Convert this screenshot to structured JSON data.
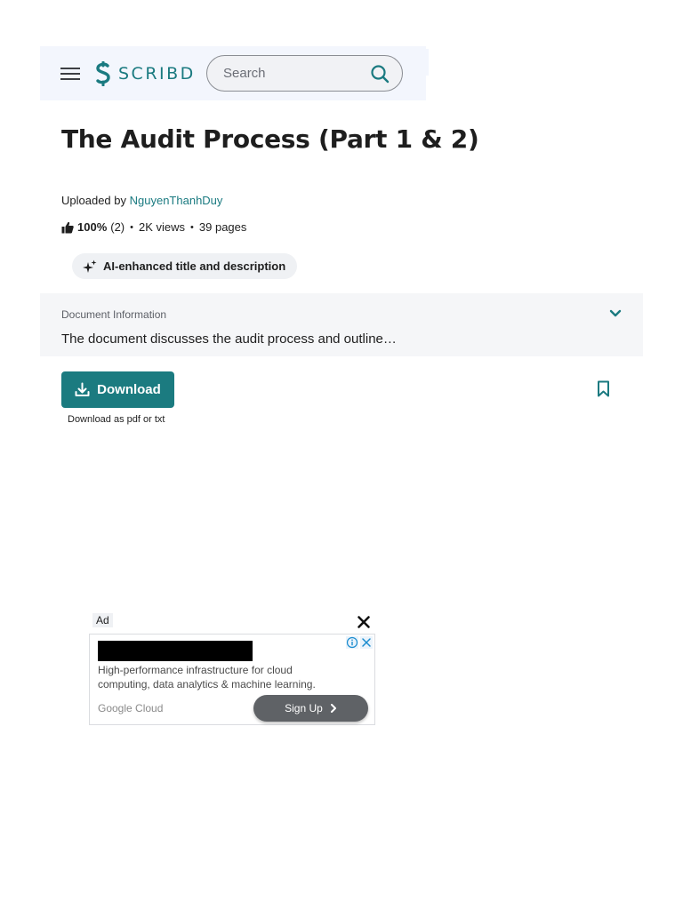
{
  "header": {
    "logo_text": "SCRIBD",
    "search_placeholder": "Search",
    "search_value": ""
  },
  "document": {
    "title": "The Audit Process (Part 1 & 2)",
    "uploaded_by_prefix": "Uploaded by",
    "uploader": "NguyenThanhDuy",
    "rating": "100%",
    "rating_count": "(2)",
    "views": "2K views",
    "pages": "39 pages",
    "ai_badge": "AI-enhanced title and description"
  },
  "doc_info": {
    "label": "Document Information",
    "description": "The document discusses the audit process and outline…"
  },
  "actions": {
    "download_label": "Download",
    "download_note": "Download as pdf or txt"
  },
  "ad": {
    "label": "Ad",
    "body": "High-performance infrastructure for cloud computing, data analytics & machine learning.",
    "brand": "Google Cloud",
    "cta": "Sign Up"
  },
  "colors": {
    "accent": "#1b7b80",
    "header_bg": "#f3f6fd",
    "info_bg": "#f5f6f8"
  },
  "icons": [
    "menu-icon",
    "scribd-logo-icon",
    "search-icon",
    "thumbs-up-icon",
    "sparkle-icon",
    "chevron-down-icon",
    "download-icon",
    "bookmark-icon",
    "close-icon",
    "ad-info-icon",
    "ad-close-icon",
    "chevron-right-icon"
  ]
}
